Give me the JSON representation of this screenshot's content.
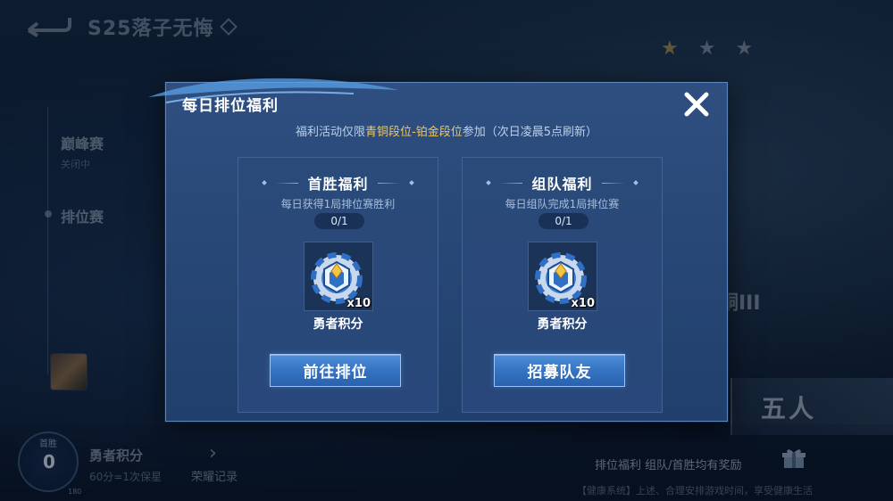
{
  "background": {
    "season_title": "S25落子无悔",
    "side_menu": [
      {
        "label": "巅峰赛",
        "sub": "关闭中"
      },
      {
        "label": "排位赛",
        "sub": ""
      }
    ],
    "rank_fragment": "铜III",
    "team_button": "五人",
    "score": {
      "label": "首胜",
      "value": "0",
      "max": "180"
    },
    "points": {
      "title": "勇者积分",
      "sub": "60分=1次保星"
    },
    "honor_record": "荣耀记录",
    "benefit_line": "排位福利 组队/首胜均有奖励",
    "system_line": "【健康系统】上述、合理安排游戏时间，享受健康生活"
  },
  "modal": {
    "title": "每日排位福利",
    "notice": {
      "prefix": "福利活动仅限",
      "highlight": "青铜段位-铂金段位",
      "suffix": "参加（次日凌晨5点刷新）"
    },
    "cards": [
      {
        "title": "首胜福利",
        "desc": "每日获得1局排位赛胜利",
        "progress": "0/1",
        "reward_count": "x10",
        "reward_name": "勇者积分",
        "button": "前往排位"
      },
      {
        "title": "组队福利",
        "desc": "每日组队完成1局排位赛",
        "progress": "0/1",
        "reward_count": "x10",
        "reward_name": "勇者积分",
        "button": "招募队友"
      }
    ]
  },
  "icons": {
    "back": "back-arrow-icon",
    "close": "close-icon",
    "reward": "brave-points-medal-icon",
    "gift": "gift-icon",
    "star": "star-icon"
  },
  "colors": {
    "highlight": "#f3c75b",
    "modal_bg": "#2b4a7a",
    "button": "#3471c0"
  }
}
